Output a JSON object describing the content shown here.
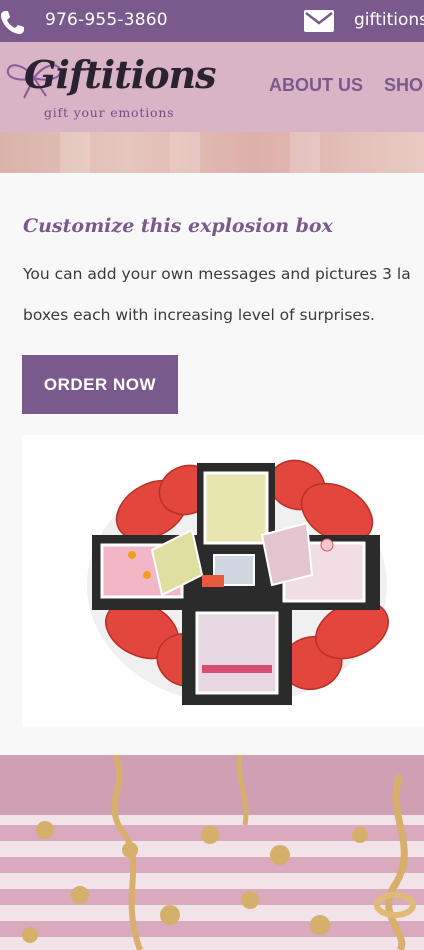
{
  "topbar": {
    "phone": "976-955-3860",
    "email": "giftitionsq",
    "bg_color": "#7a5a8c"
  },
  "header": {
    "logo_text": "Giftitions",
    "logo_tagline": "gift your emotions",
    "nav": {
      "about": "ABOUT US",
      "shop": "SHO"
    },
    "bg_color": "#d8b4c6"
  },
  "main": {
    "title": "Customize this explosion box",
    "description_line1": "You can add your own messages and pictures 3 la",
    "description_line2": "boxes each with increasing level of surprises.",
    "order_button": "ORDER NOW"
  },
  "icons": {
    "phone": "phone-icon",
    "mail": "mail-icon",
    "logo_bow": "bow-icon"
  }
}
